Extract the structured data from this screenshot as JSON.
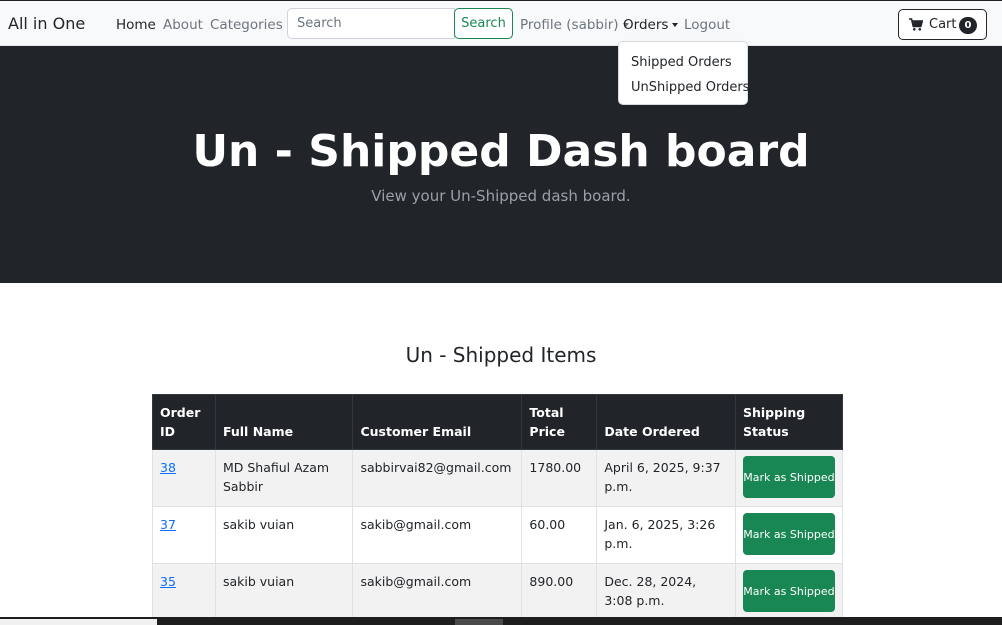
{
  "navbar": {
    "brand": "All in One",
    "home": "Home",
    "about": "About",
    "categories": "Categories",
    "search_placeholder": "Search",
    "search_button": "Search",
    "profile": "Profile (sabbir)",
    "orders": "Orders",
    "logout": "Logout",
    "cart_label": "Cart",
    "cart_count": "0"
  },
  "orders_dropdown": {
    "items": [
      "Shipped Orders",
      "UnShipped Orders"
    ]
  },
  "hero": {
    "title": "Un - Shipped Dash board",
    "subtitle": "View your Un-Shipped dash board."
  },
  "section": {
    "title": "Un - Shipped Items"
  },
  "table": {
    "headers": [
      "Order ID",
      "Full Name",
      "Customer Email",
      "Total Price",
      "Date Ordered",
      "Shipping Status"
    ],
    "rows": [
      {
        "order_id": "38",
        "full_name": "MD Shafiul Azam Sabbir",
        "email": "sabbirvai82@gmail.com",
        "total": "1780.00",
        "date": "April 6, 2025, 9:37 p.m.",
        "action": "Mark as Shipped"
      },
      {
        "order_id": "37",
        "full_name": "sakib vuian",
        "email": "sakib@gmail.com",
        "total": "60.00",
        "date": "Jan. 6, 2025, 3:26 p.m.",
        "action": "Mark as Shipped"
      },
      {
        "order_id": "35",
        "full_name": "sakib vuian",
        "email": "sakib@gmail.com",
        "total": "890.00",
        "date": "Dec. 28, 2024, 3:08 p.m.",
        "action": "Mark as Shipped"
      }
    ]
  },
  "colors": {
    "dark": "#212529",
    "success": "#198754",
    "link": "#0d6efd",
    "navbar_bg": "#f8f9fa"
  },
  "icons": {
    "cart": "cart-icon",
    "caret": "caret-down-icon"
  }
}
